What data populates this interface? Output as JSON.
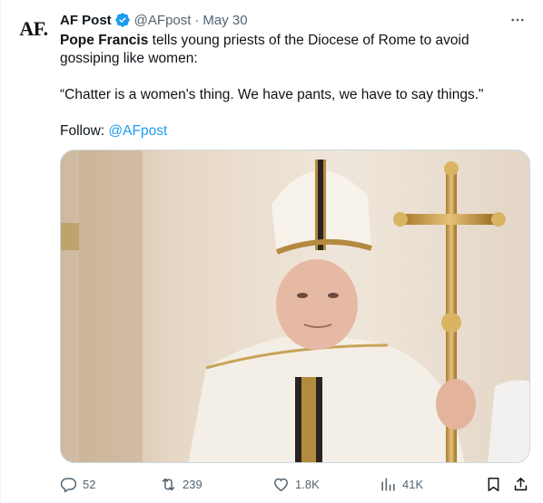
{
  "author": {
    "avatar_text": "AF.",
    "name": "AF Post",
    "handle": "@AFpost",
    "separator": "·",
    "date": "May 30"
  },
  "tweet": {
    "line1_bold": "Pope Francis",
    "line1_rest": " tells young priests of the Diocese of Rome to avoid gossiping like women:",
    "quote": "“Chatter is a women's thing. We have pants, we have to say things.\"",
    "follow_label": "Follow: ",
    "follow_link": "@AFpost"
  },
  "actions": {
    "replies": "52",
    "reposts": "239",
    "likes": "1.8K",
    "views": "41K"
  },
  "icons": {
    "more": "more-icon",
    "verified": "verified-badge-icon",
    "reply": "reply-icon",
    "repost": "repost-icon",
    "like": "heart-icon",
    "views": "views-chart-icon",
    "bookmark": "bookmark-icon",
    "share": "share-icon"
  },
  "colors": {
    "text": "#0f1419",
    "secondary": "#536471",
    "link": "#1d9bf0",
    "verified": "#1d9bf0"
  }
}
